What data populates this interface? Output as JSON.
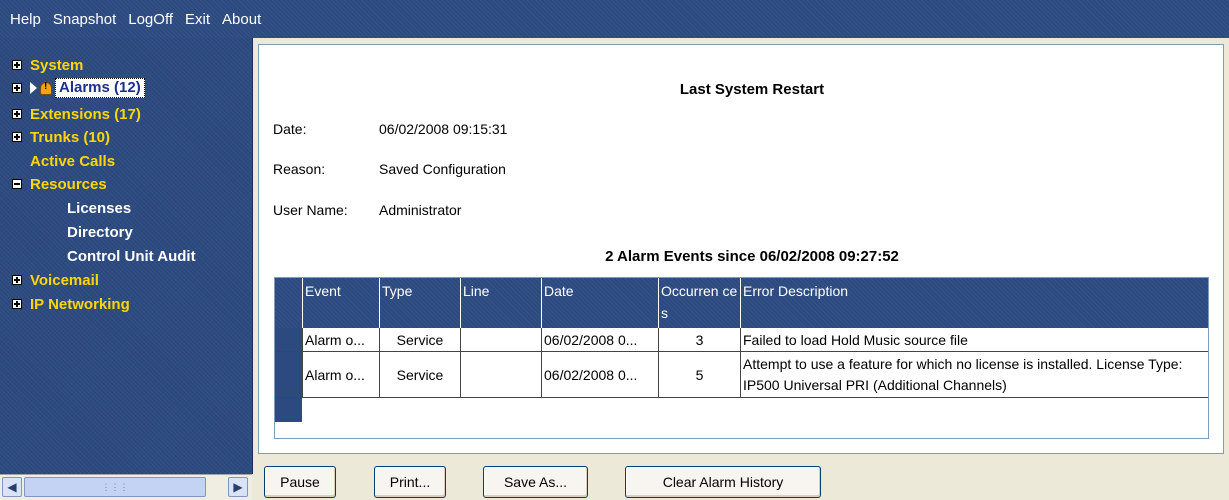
{
  "menu": [
    "Help",
    "Snapshot",
    "LogOff",
    "Exit",
    "About"
  ],
  "sidebar": {
    "items": [
      {
        "label": "System",
        "expander": "plus"
      },
      {
        "label": "Alarms (12)",
        "expander": "plus",
        "selected": true,
        "icons": [
          "arrow-icon",
          "bell-icon"
        ]
      },
      {
        "label": "Extensions (17)",
        "expander": "plus"
      },
      {
        "label": "Trunks (10)",
        "expander": "plus"
      },
      {
        "label": "Active Calls",
        "expander": "none"
      },
      {
        "label": "Resources",
        "expander": "minus"
      },
      {
        "label": "Licenses",
        "expander": "none",
        "child": true
      },
      {
        "label": "Directory",
        "expander": "none",
        "child": true
      },
      {
        "label": "Control Unit Audit",
        "expander": "none",
        "child": true
      },
      {
        "label": "Voicemail",
        "expander": "plus"
      },
      {
        "label": "IP Networking",
        "expander": "plus"
      }
    ],
    "colors": {
      "background": "#2c4a80",
      "parent_text": "#ffd700",
      "child_text": "#ffffff"
    }
  },
  "main": {
    "title": "Last System Restart",
    "fields": [
      {
        "label": "Date:",
        "value": "06/02/2008 09:15:31"
      },
      {
        "label": "Reason:",
        "value": "Saved Configuration"
      },
      {
        "label": "User Name:",
        "value": "Administrator"
      }
    ],
    "events_heading": "2 Alarm Events since 06/02/2008 09:27:52",
    "table": {
      "columns": [
        "Event",
        "Type",
        "Line",
        "Date",
        "Occurren ces",
        "Error Description"
      ],
      "rows": [
        {
          "event": "Alarm o...",
          "type": "Service",
          "line": "",
          "date": "06/02/2008 0...",
          "occurrences": "3",
          "description": "Failed to load Hold Music source file"
        },
        {
          "event": "Alarm o...",
          "type": "Service",
          "line": "",
          "date": "06/02/2008 0...",
          "occurrences": "5",
          "description": "Attempt to use a feature for which no license is installed. License Type: IP500 Universal PRI (Additional Channels)"
        }
      ]
    }
  },
  "buttons": {
    "pause": "Pause",
    "print": "Print...",
    "save_as": "Save As...",
    "clear_history": "Clear Alarm History"
  }
}
